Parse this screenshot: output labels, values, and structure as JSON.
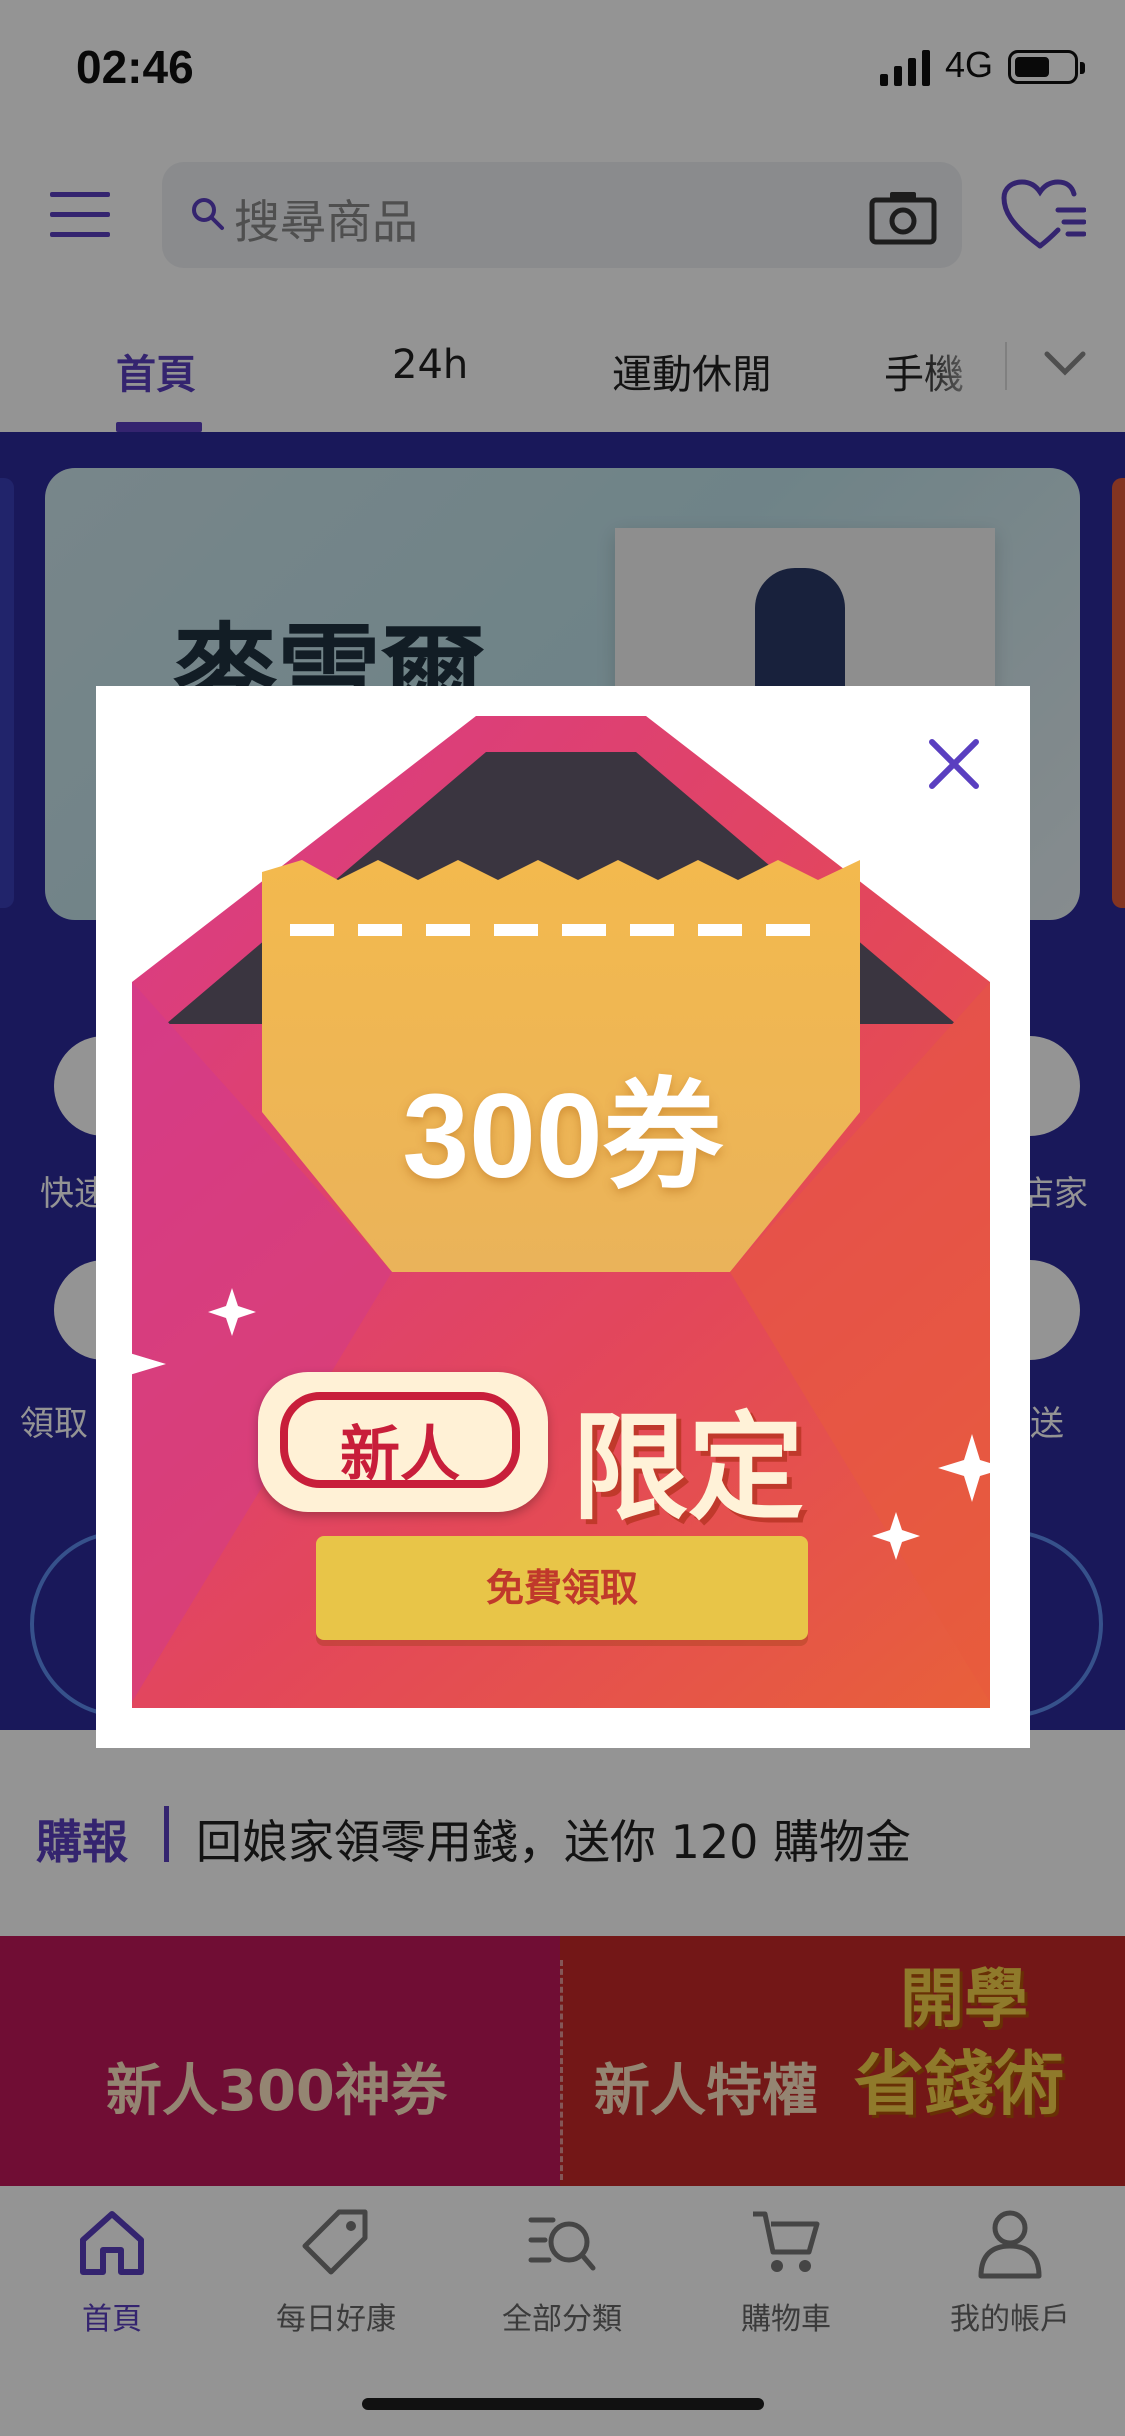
{
  "status_bar": {
    "time": "02:46",
    "network": "4G"
  },
  "header": {
    "search_placeholder": "搜尋商品"
  },
  "tabs": [
    {
      "label": "首頁"
    },
    {
      "label": "24h"
    },
    {
      "label": "運動休閒"
    },
    {
      "label": "手機"
    }
  ],
  "hero": {
    "banner_text": "麥雪爾",
    "quick_links_visible_fragments": [
      "快速",
      "店家",
      "領取",
      "送"
    ]
  },
  "news": {
    "tag": "購報",
    "text": "回娘家領零用錢，送你 120 購物金"
  },
  "promos": [
    {
      "label": "新人300神券"
    },
    {
      "label": "新人特權"
    }
  ],
  "promo_badge": {
    "line1": "開學",
    "line2": "省錢術"
  },
  "modal": {
    "coupon_amount": "300券",
    "badge": "新人",
    "headline": "限定",
    "cta": "免費領取",
    "accent_color": "#5a3fc0"
  },
  "bottom_nav": [
    {
      "label": "首頁",
      "icon": "home-icon",
      "active": true
    },
    {
      "label": "每日好康",
      "icon": "tag-icon"
    },
    {
      "label": "全部分類",
      "icon": "category-search-icon"
    },
    {
      "label": "購物車",
      "icon": "cart-icon"
    },
    {
      "label": "我的帳戶",
      "icon": "account-icon"
    }
  ]
}
